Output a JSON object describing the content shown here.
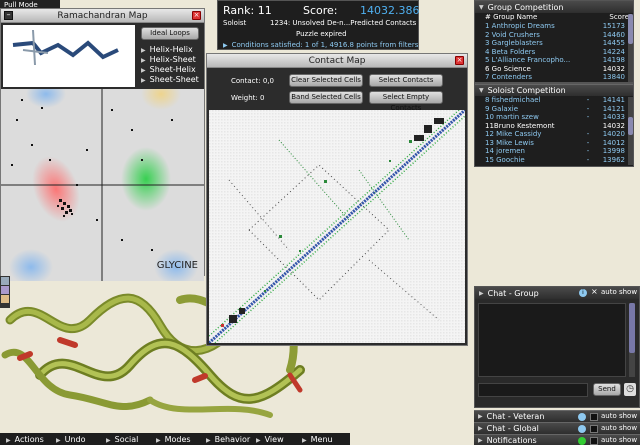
{
  "topleft": {
    "label": "Pull Mode"
  },
  "rama": {
    "title": "Ramachandran Map",
    "ideal_loops": "Ideal Loops",
    "options": [
      "Helix-Helix",
      "Helix-Sheet",
      "Sheet-Helix",
      "Sheet-Sheet"
    ],
    "residue": "GLYCINE"
  },
  "score_panel": {
    "rank_label": "Rank:",
    "rank_value": "11",
    "score_label": "Score:",
    "score_value": "14032.386",
    "mode": "Soloist",
    "puzzle": "1234: Unsolved De-n...Predicted Contacts",
    "status": "Puzzle expired",
    "conditions": "Conditions satisfied: 1 of 1, 4916.8 points from filters"
  },
  "contact_map": {
    "title": "Contact Map",
    "contact_label": "Contact: 0,0",
    "weight_label": "Weight: 0",
    "clear_button": "Clear Selected Cells",
    "select_contacts_button": "Select Contacts",
    "band_button": "Band Selected Cells",
    "select_empty_button": "Select Empty Contacts"
  },
  "group_competition": {
    "title": "Group Competition",
    "header": {
      "name": "# Group Name",
      "score": "Score"
    },
    "rows": [
      {
        "name": "1 Anthropic Dreams",
        "score": "15173",
        "highlight": false
      },
      {
        "name": "2 Void Crushers",
        "score": "14460",
        "highlight": false
      },
      {
        "name": "3 Gargleblasters",
        "score": "14455",
        "highlight": false
      },
      {
        "name": "4 Beta Folders",
        "score": "14224",
        "highlight": false
      },
      {
        "name": "5 L'Alliance Francopho...",
        "score": "14198",
        "highlight": false
      },
      {
        "name": "6 Go Science",
        "score": "14032",
        "highlight": true
      },
      {
        "name": "7 Contenders",
        "score": "13840",
        "highlight": false
      }
    ]
  },
  "soloist_competition": {
    "title": "Soloist Competition",
    "rows": [
      {
        "name": "8 fishedmichael",
        "dash": "-",
        "score": "14141",
        "highlight": false
      },
      {
        "name": "9 Galaxie",
        "dash": "-",
        "score": "14121",
        "highlight": false
      },
      {
        "name": "10 martin szew",
        "dash": "-",
        "score": "14033",
        "highlight": false
      },
      {
        "name": "11Bruno Kestemont",
        "dash": "",
        "score": "14032",
        "highlight": true
      },
      {
        "name": "12 Mike Cassidy",
        "dash": "-",
        "score": "14020",
        "highlight": false
      },
      {
        "name": "13 Mike Lewis",
        "dash": "-",
        "score": "14012",
        "highlight": false
      },
      {
        "name": "14 joremen",
        "dash": "-",
        "score": "13998",
        "highlight": false
      },
      {
        "name": "15 Goochie",
        "dash": "-",
        "score": "13962",
        "highlight": false
      }
    ]
  },
  "chat_group": {
    "title": "Chat - Group",
    "auto_show": "auto show",
    "send": "Send"
  },
  "chat_rows": [
    {
      "title": "Chat - Veteran",
      "auto_show": "auto show",
      "icon": "info",
      "status_color": "#8ec9f0"
    },
    {
      "title": "Chat - Global",
      "auto_show": "auto show",
      "icon": "info",
      "status_color": "#8ec9f0"
    },
    {
      "title": "Notifications",
      "auto_show": "auto show",
      "icon": "green",
      "status_color": "#3c3"
    }
  ],
  "menu": [
    "Actions",
    "Undo",
    "Social",
    "Modes",
    "Behavior",
    "View",
    "Menu"
  ],
  "colors": {
    "link_blue": "#8ec9f0",
    "score_blue": "#4fb0f0",
    "highlight_row": "#ffffff"
  }
}
